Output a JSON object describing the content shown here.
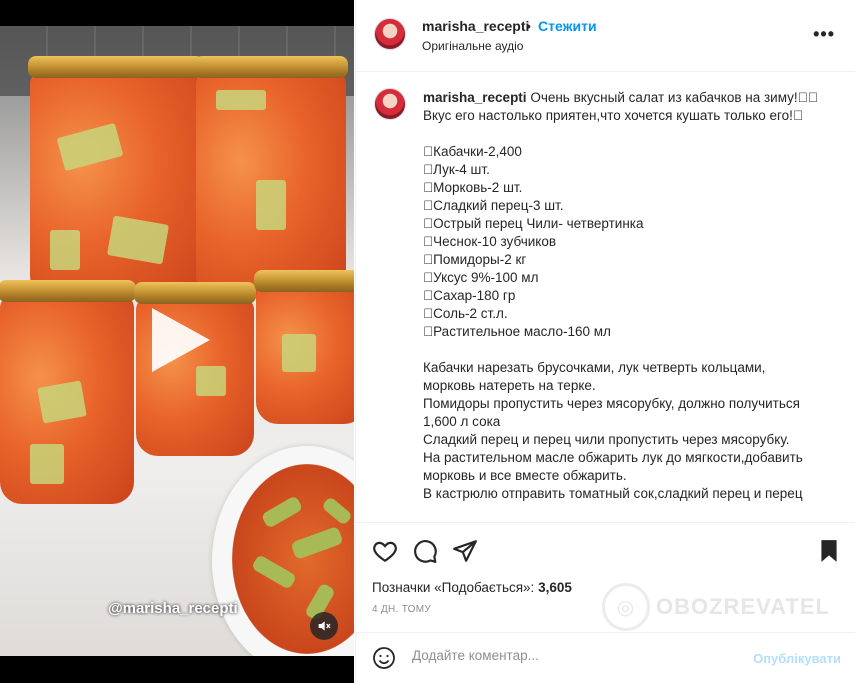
{
  "media": {
    "overlay_handle": "@marisha_recepti"
  },
  "header": {
    "username": "marisha_recepti",
    "separator": "•",
    "follow_label": "Стежити",
    "audio_label": "Оригінальне аудіо",
    "more_label": "•••"
  },
  "caption": {
    "username": "marisha_recepti",
    "intro": " Очень вкусный салат из кабачков на зиму!􏿾􏿾",
    "intro2": "Вкус его настолько приятен,что хочется кушать только его!􏿾",
    "ingredients": [
      "􏿾Кабачки-2,400",
      "􏿾Лук-4 шт.",
      "􏿾Морковь-2 шт.",
      "􏿾Сладкий перец-3 шт.",
      "􏿾Острый перец Чили- четвертинка",
      "􏿾Чеснок-10 зубчиков",
      "􏿾Помидоры-2 кг",
      "􏿾Уксус 9%-100 мл",
      "􏿾Сахар-180 гр",
      "􏿾Соль-2 ст.л.",
      "􏿾Растительное масло-160 мл"
    ],
    "steps": [
      "Кабачки нарезать брусочками, лук четверть кольцами,",
      "морковь натереть на терке.",
      "Помидоры пропустить через мясорубку, должно получиться",
      "1,600 л сока",
      "Сладкий перец и перец чили пропустить через мясорубку.",
      "На растительном масле обжарить лук до мягкости,добавить",
      "морковь и все вместе обжарить.",
      "В кастрюлю отправить томатный сок,сладкий перец и перец"
    ]
  },
  "actions": {
    "likes_prefix": "Позначки «Подобається»: ",
    "likes_count": "3,605",
    "time": "4 ДН. ТОМУ",
    "watermark": "OBOZREVATEL"
  },
  "comment": {
    "placeholder": "Додайте коментар...",
    "publish_label": "Опублікувати"
  },
  "icons": [
    "heart-icon",
    "comment-icon",
    "share-icon",
    "bookmark-icon",
    "emoji-icon",
    "mute-icon",
    "play-icon",
    "more-icon"
  ]
}
